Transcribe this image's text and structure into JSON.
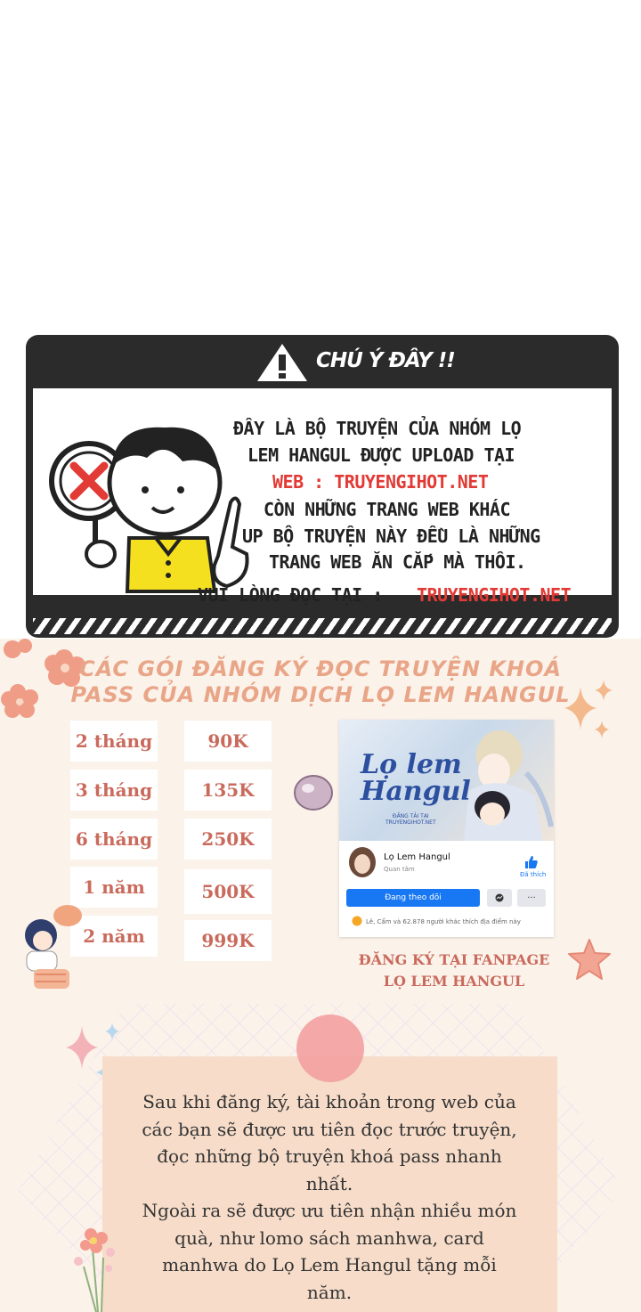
{
  "warning": {
    "title": "CHÚ Ý ĐÂY !!",
    "lines": [
      "ĐÂY LÀ BỘ TRUYỆN CỦA NHÓM LỌ",
      "LEM HANGUL ĐƯỢC UPLOAD TẠI",
      "WEB : TRUYENGIHOT.NET",
      "CÒN NHỮNG TRANG WEB KHÁC",
      "UP BỘ TRUYỆN NÀY ĐỀU LÀ NHỮNG",
      "TRANG WEB ĂN CẮP MÀ THÔI."
    ],
    "read_at_label": "VUI LÒNG ĐỌC TẠI :",
    "read_at_site": "TRUYENGIHOT.NET"
  },
  "promo": {
    "title_line1": "CÁC GÓI ĐĂNG KÝ ĐỌC TRUYỆN KHOÁ",
    "title_line2": "PASS CỦA NHÓM DỊCH LỌ LEM HANGUL",
    "plans": [
      {
        "duration": "2 tháng",
        "price": "90K"
      },
      {
        "duration": "3 tháng",
        "price": "135K"
      },
      {
        "duration": "6 tháng",
        "price": "250K"
      },
      {
        "duration": "1 năm",
        "price": "500K"
      },
      {
        "duration": "2 năm",
        "price": "999K"
      }
    ],
    "fanpage": {
      "logo_line1": "Lọ lem",
      "logo_line2": "Hangul",
      "logo_sub1": "ĐĂNG TẢI TẠI",
      "logo_sub2": "TRUYENGIHOT.NET",
      "page_name": "Lọ Lem Hangul",
      "page_meta": "Quan tâm",
      "like_label": "Đã thích",
      "follow_label": "Đang theo dõi",
      "message_icon": "messenger-icon",
      "more_label": "···",
      "likes_text": "Lê, Cẩm và 62.878 người khác thích địa điểm này"
    },
    "fanpage_caption_line1": "ĐĂNG KÝ TẠI FANPAGE",
    "fanpage_caption_line2": "LỌ LEM HANGUL",
    "info_lines": [
      "Sau khi đăng ký, tài khoản trong web của",
      "các bạn sẽ được ưu tiên đọc trước truyện,",
      "đọc những bộ truyện khoá pass nhanh",
      "nhất.",
      "Ngoài ra sẽ được ưu tiên nhận nhiều món",
      "quà, như lomo sách manhwa, card",
      "manhwa do Lọ Lem Hangul tặng mỗi",
      "năm."
    ]
  }
}
